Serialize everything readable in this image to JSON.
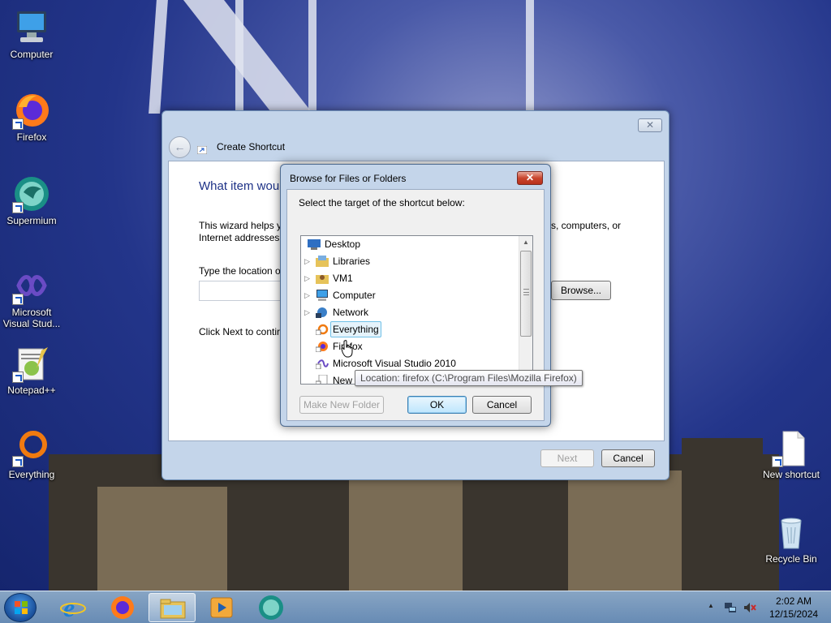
{
  "desktop": {
    "icons": [
      {
        "label": "Computer"
      },
      {
        "label": "Firefox"
      },
      {
        "label": "Supermium"
      },
      {
        "label": "Microsoft Visual Stud..."
      },
      {
        "label": "Notepad++"
      },
      {
        "label": "Everything"
      },
      {
        "label": "New shortcut"
      },
      {
        "label": "Recycle Bin"
      }
    ]
  },
  "wizard": {
    "title": "Create Shortcut",
    "heading": "What item wou",
    "description_left": "This wizard helps yo",
    "description_right": "s, computers, or",
    "description_line2": "Internet addresses.",
    "type_location_label": "Type the location o",
    "location_value": "",
    "browse_label": "Browse...",
    "click_next_text": "Click Next to contir",
    "next_label": "Next",
    "cancel_label": "Cancel",
    "close_glyph": "✕"
  },
  "browse_dialog": {
    "title": "Browse for Files or Folders",
    "prompt": "Select the target of the shortcut below:",
    "close_glyph": "✕",
    "tree": [
      {
        "label": "Desktop",
        "icon": "desktop-icon",
        "expandable": false
      },
      {
        "label": "Libraries",
        "icon": "libraries-icon",
        "expandable": true
      },
      {
        "label": "VM1",
        "icon": "user-folder-icon",
        "expandable": true
      },
      {
        "label": "Computer",
        "icon": "computer-icon",
        "expandable": true
      },
      {
        "label": "Network",
        "icon": "network-icon",
        "expandable": true
      },
      {
        "label": "Everything",
        "icon": "everything-shortcut-icon",
        "expandable": false
      },
      {
        "label": "Firefox",
        "icon": "firefox-shortcut-icon",
        "expandable": false
      },
      {
        "label": "Microsoft Visual Studio 2010",
        "icon": "vs-shortcut-icon",
        "expandable": false
      },
      {
        "label": "New",
        "icon": "shortcut-icon",
        "expandable": false
      }
    ],
    "make_new_folder_label": "Make New Folder",
    "ok_label": "OK",
    "cancel_label": "Cancel",
    "tooltip": "Location: firefox (C:\\Program Files\\Mozilla Firefox)"
  },
  "taskbar": {
    "pinned": [
      "start-orb",
      "ie-icon",
      "firefox-icon",
      "explorer-icon",
      "media-player-icon",
      "supermium-icon"
    ],
    "tray_chevron": "▲",
    "time": "2:02 AM",
    "date": "12/15/2024"
  },
  "colors": {
    "heading": "#1e3287",
    "window_frame": "#c4d5ea",
    "close_red": "#c9462f",
    "taskbar": "#8fb2d8"
  }
}
